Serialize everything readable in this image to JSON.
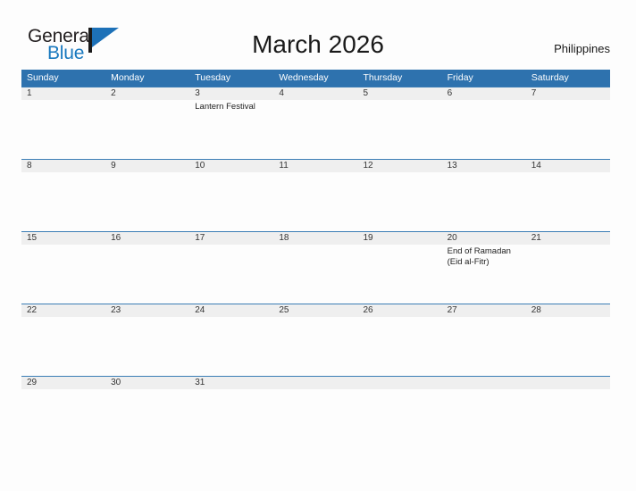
{
  "logo": {
    "word_one": "General",
    "word_two": "Blue",
    "mark": "sail-triangle"
  },
  "header": {
    "title": "March 2026",
    "country": "Philippines"
  },
  "colors": {
    "header_blue": "#2e72ae",
    "row_line_blue": "#3b7db5",
    "row_band_gray": "#efefef",
    "logo_blue": "#1878be",
    "page_background": "#fdfdfd"
  },
  "calendar": {
    "weekdays": [
      "Sunday",
      "Monday",
      "Tuesday",
      "Wednesday",
      "Thursday",
      "Friday",
      "Saturday"
    ],
    "weeks": [
      {
        "days": [
          {
            "date": "1",
            "events": []
          },
          {
            "date": "2",
            "events": []
          },
          {
            "date": "3",
            "events": [
              "Lantern Festival"
            ]
          },
          {
            "date": "4",
            "events": []
          },
          {
            "date": "5",
            "events": []
          },
          {
            "date": "6",
            "events": []
          },
          {
            "date": "7",
            "events": []
          }
        ]
      },
      {
        "days": [
          {
            "date": "8",
            "events": []
          },
          {
            "date": "9",
            "events": []
          },
          {
            "date": "10",
            "events": []
          },
          {
            "date": "11",
            "events": []
          },
          {
            "date": "12",
            "events": []
          },
          {
            "date": "13",
            "events": []
          },
          {
            "date": "14",
            "events": []
          }
        ]
      },
      {
        "days": [
          {
            "date": "15",
            "events": []
          },
          {
            "date": "16",
            "events": []
          },
          {
            "date": "17",
            "events": []
          },
          {
            "date": "18",
            "events": []
          },
          {
            "date": "19",
            "events": []
          },
          {
            "date": "20",
            "events": [
              "End of Ramadan",
              "(Eid al-Fitr)"
            ]
          },
          {
            "date": "21",
            "events": []
          }
        ]
      },
      {
        "days": [
          {
            "date": "22",
            "events": []
          },
          {
            "date": "23",
            "events": []
          },
          {
            "date": "24",
            "events": []
          },
          {
            "date": "25",
            "events": []
          },
          {
            "date": "26",
            "events": []
          },
          {
            "date": "27",
            "events": []
          },
          {
            "date": "28",
            "events": []
          }
        ]
      },
      {
        "days": [
          {
            "date": "29",
            "events": []
          },
          {
            "date": "30",
            "events": []
          },
          {
            "date": "31",
            "events": []
          },
          {
            "date": "",
            "events": []
          },
          {
            "date": "",
            "events": []
          },
          {
            "date": "",
            "events": []
          },
          {
            "date": "",
            "events": []
          }
        ]
      }
    ]
  }
}
